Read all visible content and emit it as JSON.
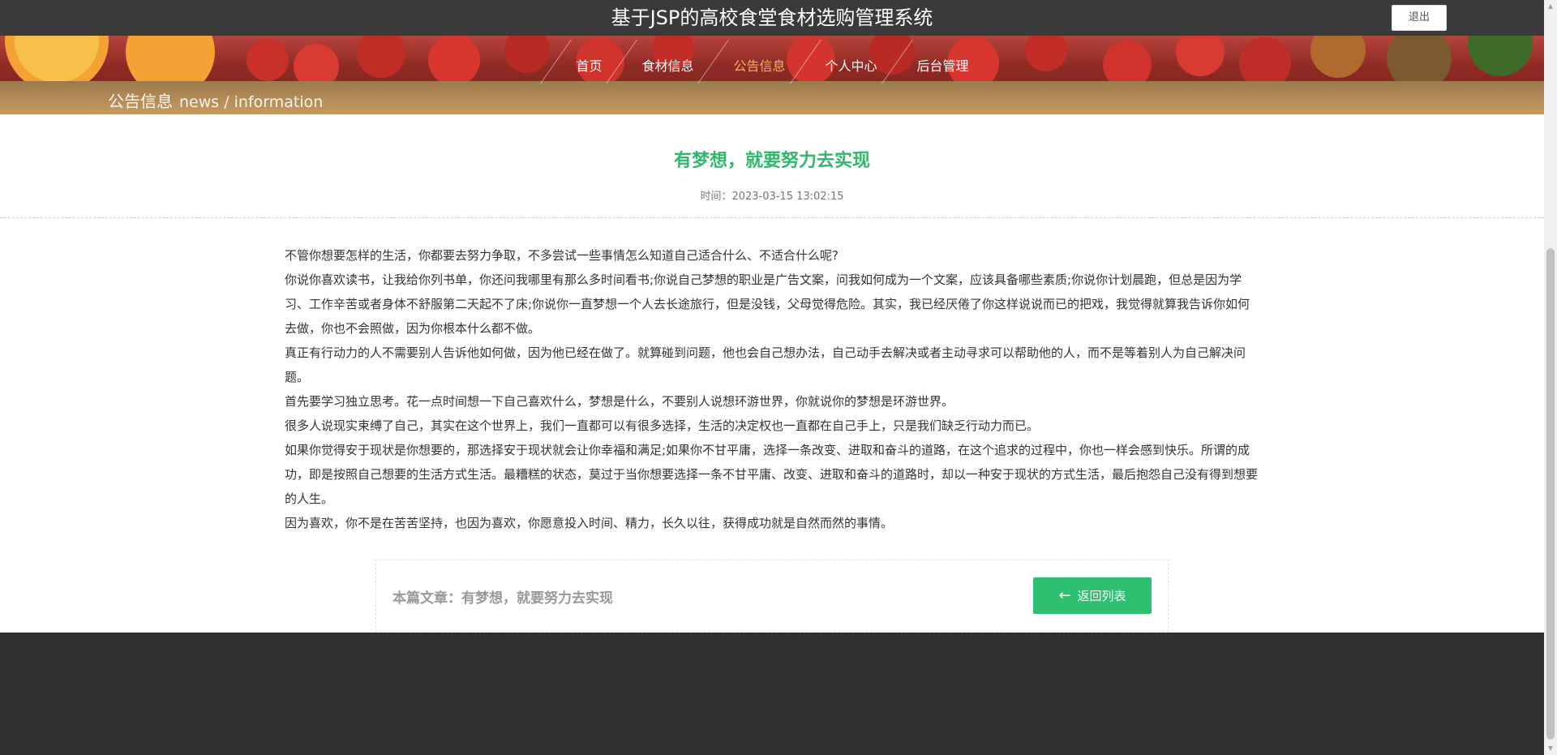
{
  "header": {
    "title": "基于JSP的高校食堂食材选购管理系统",
    "logout_label": "退出"
  },
  "nav": {
    "items": [
      {
        "label": "首页"
      },
      {
        "label": "食材信息"
      },
      {
        "label": "公告信息"
      },
      {
        "label": "个人中心"
      },
      {
        "label": "后台管理"
      }
    ],
    "active": "公告信息"
  },
  "breadcrumb": {
    "cn": "公告信息",
    "en": "news / information"
  },
  "article": {
    "title": "有梦想，就要努力去实现",
    "time": "时间：2023-03-15 13:02:15",
    "paragraphs": [
      "不管你想要怎样的生活，你都要去努力争取，不多尝试一些事情怎么知道自己适合什么、不适合什么呢?",
      "你说你喜欢读书，让我给你列书单，你还问我哪里有那么多时间看书;你说自己梦想的职业是广告文案，问我如何成为一个文案，应该具备哪些素质;你说你计划晨跑，但总是因为学习、工作辛苦或者身体不舒服第二天起不了床;你说你一直梦想一个人去长途旅行，但是没钱，父母觉得危险。其实，我已经厌倦了你这样说说而已的把戏，我觉得就算我告诉你如何去做，你也不会照做，因为你根本什么都不做。",
      "真正有行动力的人不需要别人告诉他如何做，因为他已经在做了。就算碰到问题，他也会自己想办法，自己动手去解决或者主动寻求可以帮助他的人，而不是等着别人为自己解决问题。",
      "首先要学习独立思考。花一点时间想一下自己喜欢什么，梦想是什么，不要别人说想环游世界，你就说你的梦想是环游世界。",
      "很多人说现实束缚了自己，其实在这个世界上，我们一直都可以有很多选择，生活的决定权也一直都在自己手上，只是我们缺乏行动力而已。",
      "如果你觉得安于现状是你想要的，那选择安于现状就会让你幸福和满足;如果你不甘平庸，选择一条改变、进取和奋斗的道路，在这个追求的过程中，你也一样会感到快乐。所谓的成功，即是按照自己想要的生活方式生活。最糟糕的状态，莫过于当你想要选择一条不甘平庸、改变、进取和奋斗的道路时，却以一种安于现状的方式生活，最后抱怨自己没有得到想要的人生。",
      "因为喜欢，你不是在苦苦坚持，也因为喜欢，你愿意投入时间、精力，长久以往，获得成功就是自然而然的事情。"
    ]
  },
  "footer_box": {
    "label": "本篇文章：有梦想，就要努力去实现",
    "back_label": "返回列表",
    "back_icon": "arrow-left-icon"
  },
  "colors": {
    "topbar": "#3a3a3a",
    "accent_green": "#2fbf71",
    "nav_active": "#f0b36a",
    "footer": "#2f2f2f"
  }
}
